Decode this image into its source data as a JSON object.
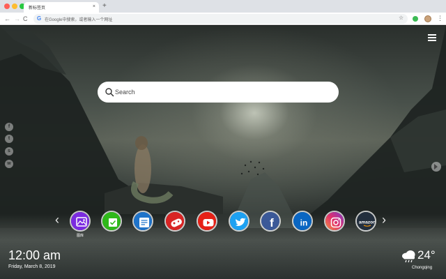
{
  "browser": {
    "tab_title": "新标签页",
    "tab_close": "×",
    "new_tab": "+",
    "back": "←",
    "forward": "→",
    "reload": "C",
    "omnibox_placeholder": "在Google中搜索，或者输入一个网址",
    "bookmark_star": "☆",
    "menu": "⋮"
  },
  "page": {
    "search": {
      "placeholder": "Search"
    },
    "social": [
      {
        "name": "facebook",
        "glyph": "f"
      },
      {
        "name": "twitter",
        "glyph": "t"
      },
      {
        "name": "snapchat",
        "glyph": "s"
      },
      {
        "name": "wechat",
        "glyph": "w"
      }
    ],
    "nav": {
      "prev": "‹",
      "next": "›"
    },
    "dock": [
      {
        "name": "gallery",
        "label": "图库"
      },
      {
        "name": "tasks"
      },
      {
        "name": "notes"
      },
      {
        "name": "games"
      },
      {
        "name": "youtube"
      },
      {
        "name": "twitter"
      },
      {
        "name": "facebook",
        "glyph": "f"
      },
      {
        "name": "linkedin",
        "glyph": "in"
      },
      {
        "name": "instagram"
      },
      {
        "name": "amazon",
        "glyph": "amazon"
      }
    ],
    "clock": {
      "time": "12:00 am",
      "date": "Friday, March 8, 2019"
    },
    "weather": {
      "temp": "24°",
      "city": "Chongqing",
      "icon": "cloud-rain-icon"
    }
  },
  "colors": {
    "gallery": "#7b2be0",
    "tasks": "#2fb81a",
    "notes": "#1f73c9",
    "games": "#d92424",
    "youtube": "#e62117",
    "twitter": "#1da1f2",
    "facebook": "#3b5998",
    "linkedin": "#0a66c2",
    "amazon": "#232f3e"
  }
}
